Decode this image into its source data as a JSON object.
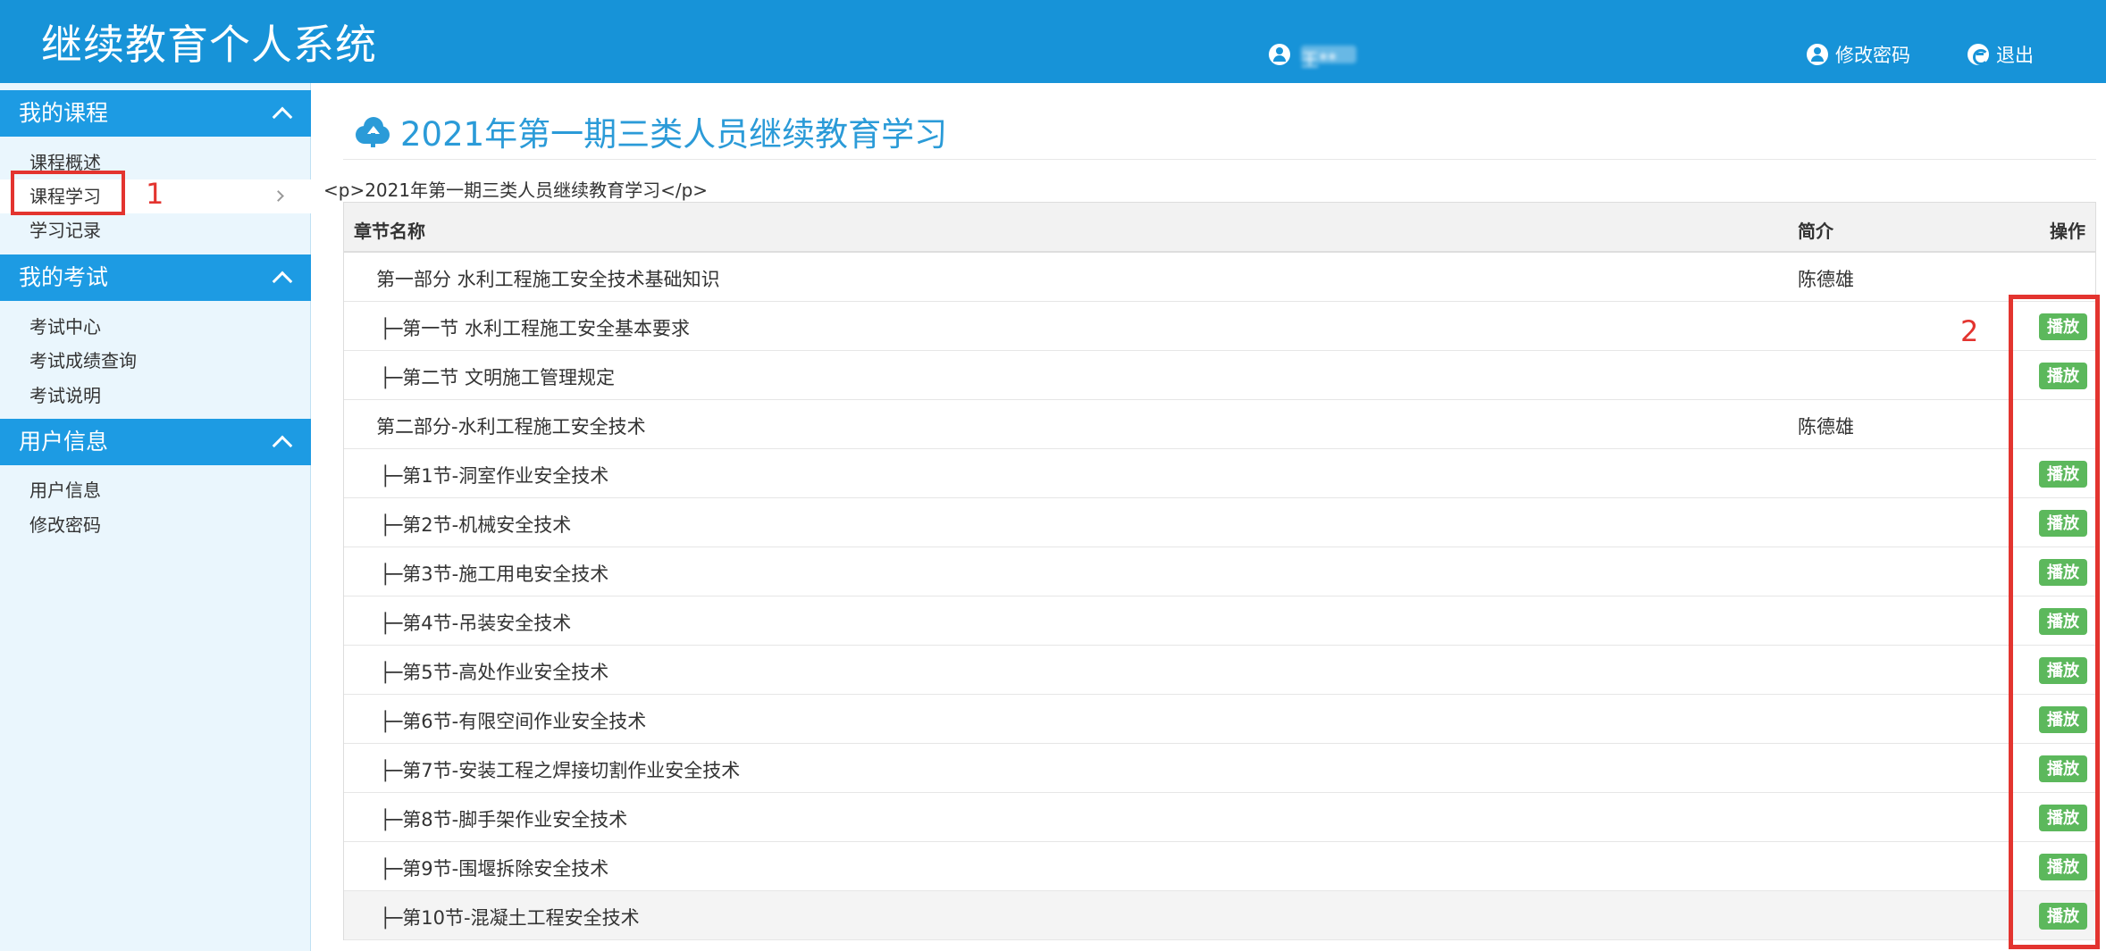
{
  "header": {
    "title": "继续教育个人系统",
    "user_name": "王**",
    "change_password": "修改密码",
    "logout": "退出"
  },
  "sidebar": {
    "sections": [
      {
        "title": "我的课程",
        "items": [
          "课程概述",
          "课程学习",
          "学习记录"
        ]
      },
      {
        "title": "我的考试",
        "items": [
          "考试中心",
          "考试成绩查询",
          "考试说明"
        ]
      },
      {
        "title": "用户信息",
        "items": [
          "用户信息",
          "修改密码"
        ]
      }
    ],
    "active_item": "课程学习"
  },
  "annotations": {
    "mark1": "1",
    "mark2": "2"
  },
  "main": {
    "title": "2021年第一期三类人员继续教育学习",
    "raw_html_text": "<p>2021年第一期三类人员继续教育学习</p>",
    "table": {
      "headers": {
        "name": "章节名称",
        "intro": "简介",
        "action": "操作"
      },
      "play_label": "播放",
      "rows": [
        {
          "name": "第一部分 水利工程施工安全技术基础知识",
          "intro": "陈德雄",
          "type": "part"
        },
        {
          "name": "├─第一节 水利工程施工安全基本要求",
          "intro": "",
          "type": "section"
        },
        {
          "name": "├─第二节 文明施工管理规定",
          "intro": "",
          "type": "section"
        },
        {
          "name": "第二部分-水利工程施工安全技术",
          "intro": "陈德雄",
          "type": "part"
        },
        {
          "name": "├─第1节-洞室作业安全技术",
          "intro": "",
          "type": "section"
        },
        {
          "name": "├─第2节-机械安全技术",
          "intro": "",
          "type": "section"
        },
        {
          "name": "├─第3节-施工用电安全技术",
          "intro": "",
          "type": "section"
        },
        {
          "name": "├─第4节-吊装安全技术",
          "intro": "",
          "type": "section"
        },
        {
          "name": "├─第5节-高处作业安全技术",
          "intro": "",
          "type": "section"
        },
        {
          "name": "├─第6节-有限空间作业安全技术",
          "intro": "",
          "type": "section"
        },
        {
          "name": "├─第7节-安装工程之焊接切割作业安全技术",
          "intro": "",
          "type": "section"
        },
        {
          "name": "├─第8节-脚手架作业安全技术",
          "intro": "",
          "type": "section"
        },
        {
          "name": "├─第9节-围堰拆除安全技术",
          "intro": "",
          "type": "section"
        },
        {
          "name": "├─第10节-混凝土工程安全技术",
          "intro": "",
          "type": "section"
        }
      ]
    }
  }
}
